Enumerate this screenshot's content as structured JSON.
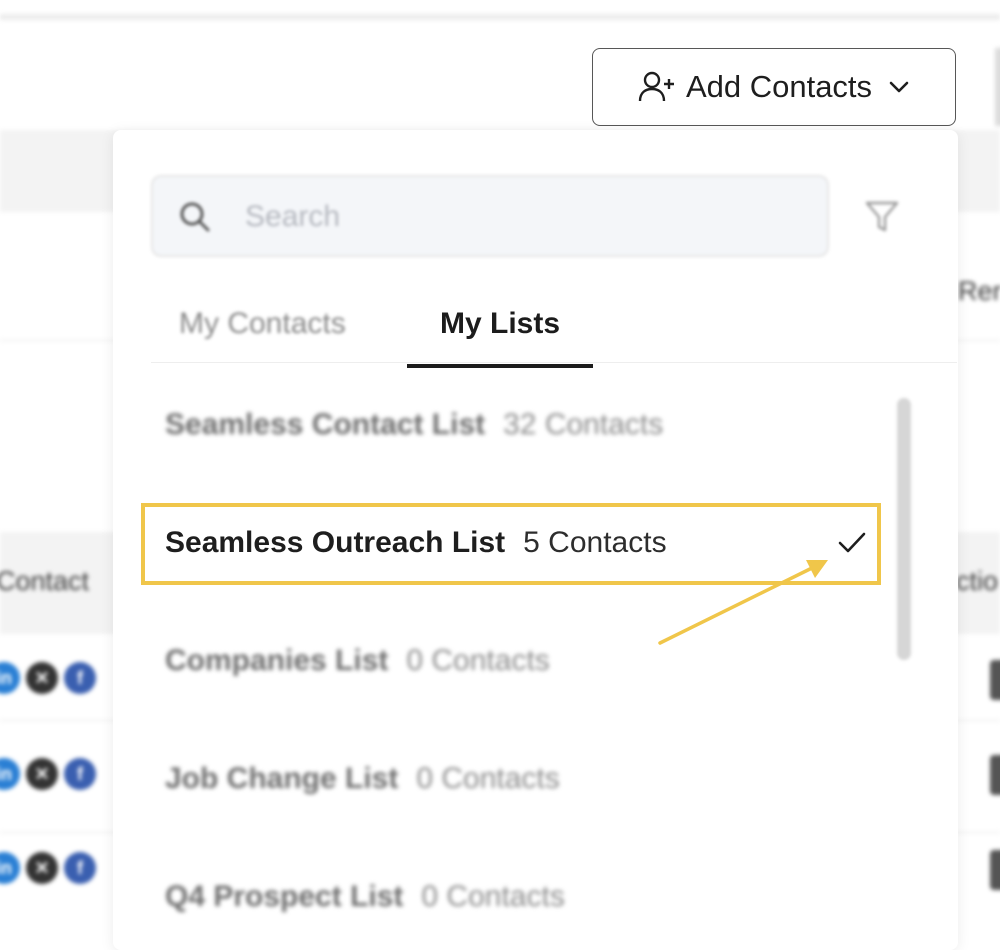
{
  "toolbar": {
    "add_contacts_label": "Add Contacts",
    "add_contacts_icon": "user-plus-icon",
    "dropdown_icon": "chevron-down-icon"
  },
  "background": {
    "right_header_fragment": "Rer",
    "left_column_fragment": "Contact",
    "right_column_fragment": "ctio",
    "row_social_icons": [
      "linkedin-icon",
      "x-icon",
      "facebook-icon"
    ]
  },
  "dropdown": {
    "search": {
      "placeholder": "Search",
      "value": "",
      "icon": "search-icon"
    },
    "filter_icon": "filter-icon",
    "tabs": [
      {
        "label": "My Contacts",
        "active": false
      },
      {
        "label": "My Lists",
        "active": true
      }
    ],
    "lists": [
      {
        "name": "Seamless Contact List",
        "count": "32 Contacts",
        "selected": false
      },
      {
        "name": "Seamless Outreach List",
        "count": "5 Contacts",
        "selected": true
      },
      {
        "name": "Companies List",
        "count": "0 Contacts",
        "selected": false
      },
      {
        "name": "Job Change List",
        "count": "0 Contacts",
        "selected": false
      },
      {
        "name": "Q4 Prospect List",
        "count": "0 Contacts",
        "selected": false
      }
    ],
    "selected_icon": "check-icon"
  },
  "annotation": {
    "highlight_color": "#f0c64a",
    "arrow_color": "#f0c64a"
  }
}
